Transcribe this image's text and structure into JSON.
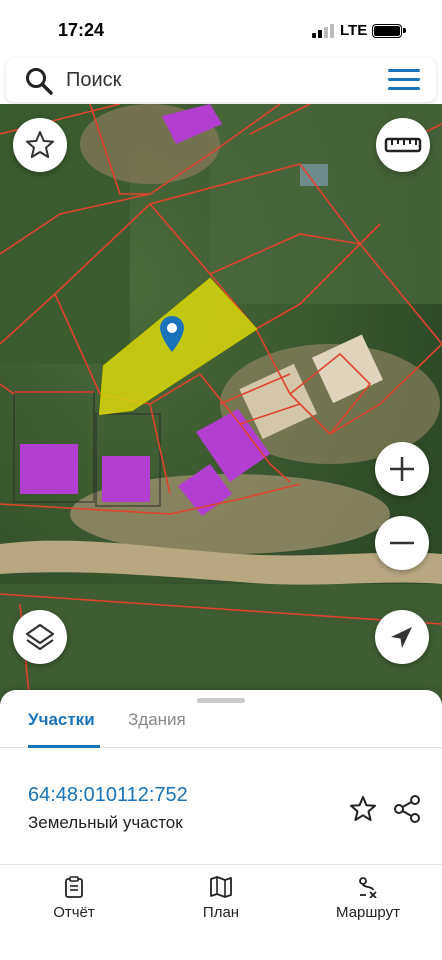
{
  "status": {
    "time": "17:24",
    "network": "LTE"
  },
  "search": {
    "placeholder": "Поиск"
  },
  "tabs": [
    {
      "label": "Участки",
      "active": true
    },
    {
      "label": "Здания",
      "active": false
    }
  ],
  "selected_parcel": {
    "cadastral_number": "64:48:010112:752",
    "type": "Земельный участок"
  },
  "bottom_nav": [
    {
      "label": "Отчёт",
      "icon": "report-icon"
    },
    {
      "label": "План",
      "icon": "map-plan-icon"
    },
    {
      "label": "Маршрут",
      "icon": "route-icon"
    }
  ],
  "colors": {
    "accent": "#1a73b8",
    "parcel_highlight": "#d8d80a",
    "building": "#b23fd1",
    "boundary": "#e0442c"
  }
}
